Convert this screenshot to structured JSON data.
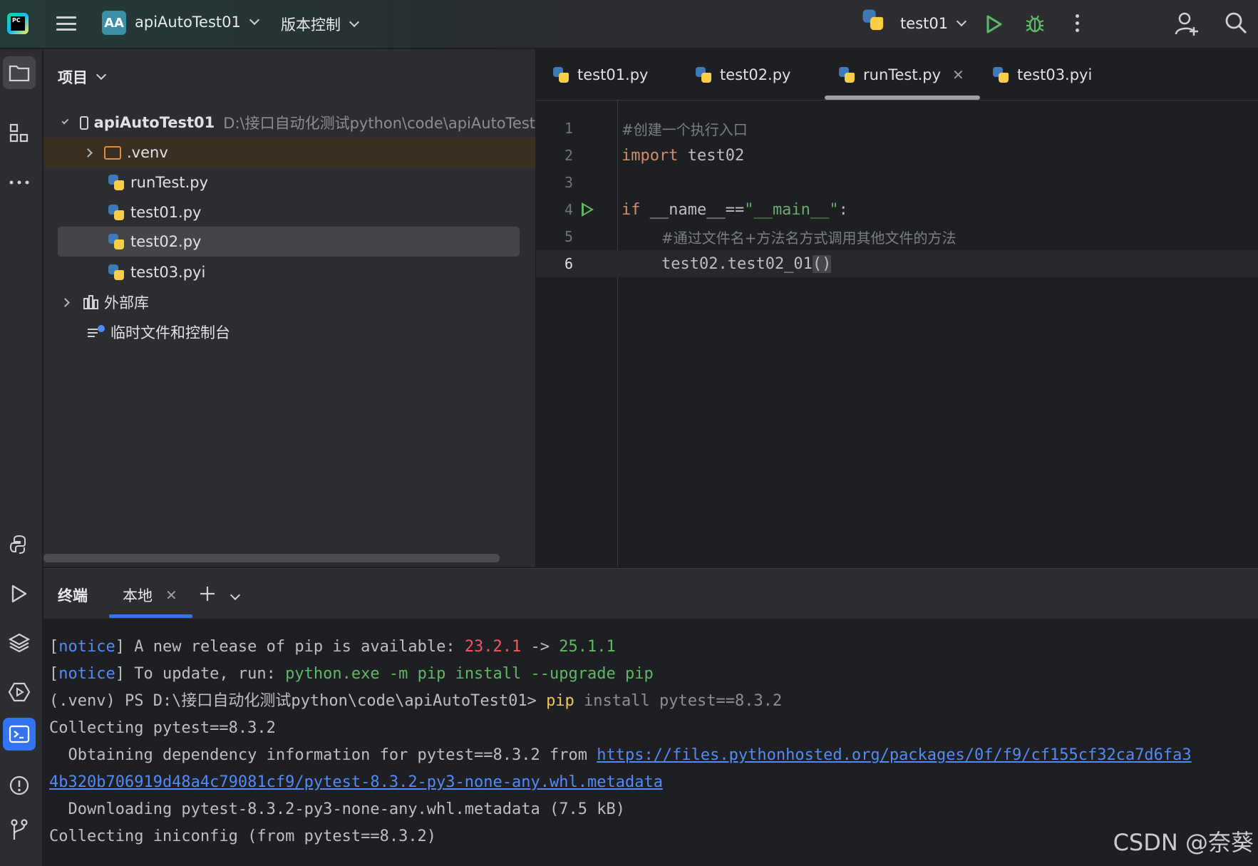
{
  "topbar": {
    "logo_text": "PC",
    "project_badge": "AA",
    "project_name": "apiAutoTest01",
    "vcs_label": "版本控制",
    "run_config": "test01"
  },
  "project_panel": {
    "title": "项目",
    "root_name": "apiAutoTest01",
    "root_path": "D:\\接口自动化测试python\\code\\apiAutoTest",
    "items": [
      {
        "label": ".venv"
      },
      {
        "label": "runTest.py"
      },
      {
        "label": "test01.py"
      },
      {
        "label": "test02.py"
      },
      {
        "label": "test03.pyi"
      }
    ],
    "external_libs": "外部库",
    "scratches": "临时文件和控制台"
  },
  "editor": {
    "tabs": [
      {
        "label": "test01.py"
      },
      {
        "label": "test02.py"
      },
      {
        "label": "runTest.py",
        "active": true
      },
      {
        "label": "test03.pyi"
      }
    ],
    "line_numbers": [
      "1",
      "2",
      "3",
      "4",
      "5",
      "6"
    ],
    "code": {
      "l1_comment": "#创建一个执行入口",
      "l2_kw": "import",
      "l2_rest": " test02",
      "l4_kw": "if",
      "l4_mid": " __name__==",
      "l4_str": "\"__main__\"",
      "l4_end": ":",
      "l5_comment": "#通过文件名+方法名方式调用其他文件的方法",
      "l6_code": "test02.test02_01",
      "l6_parens": "()"
    }
  },
  "terminal": {
    "title": "终端",
    "tab_label": "本地",
    "lines": {
      "n1_open": "[",
      "n1_notice": "notice",
      "n1_text": "] A new release of pip is available: ",
      "n1_old": "23.2.1",
      "n1_arrow": " -> ",
      "n1_new": "25.1.1",
      "n2_open": "[",
      "n2_notice": "notice",
      "n2_text": "] To update, run: ",
      "n2_cmd": "python.exe -m pip install --upgrade pip",
      "p_prompt": "(.venv) PS D:\\接口自动化测试python\\code\\apiAutoTest01> ",
      "p_cmd": "pip",
      "p_args": " install pytest==8.3.2",
      "c1": "Collecting pytest==8.3.2",
      "o_text": "  Obtaining dependency information for pytest==8.3.2 from ",
      "o_link": "https://files.pythonhosted.org/packages/0f/f9/cf155cf32ca7d6fa3",
      "o_link2": "4b320b706919d48a4c79081cf9/pytest-8.3.2-py3-none-any.whl.metadata",
      "d1": "  Downloading pytest-8.3.2-py3-none-any.whl.metadata (7.5 kB)",
      "c2": "Collecting iniconfig (from pytest==8.3.2)"
    }
  },
  "watermark": "CSDN @奈葵",
  "colors": {
    "accent": "#3574f0",
    "run_green": "#5fb865",
    "keyword": "#cf8e6d",
    "string": "#6aab73",
    "comment": "#7a7e85"
  }
}
